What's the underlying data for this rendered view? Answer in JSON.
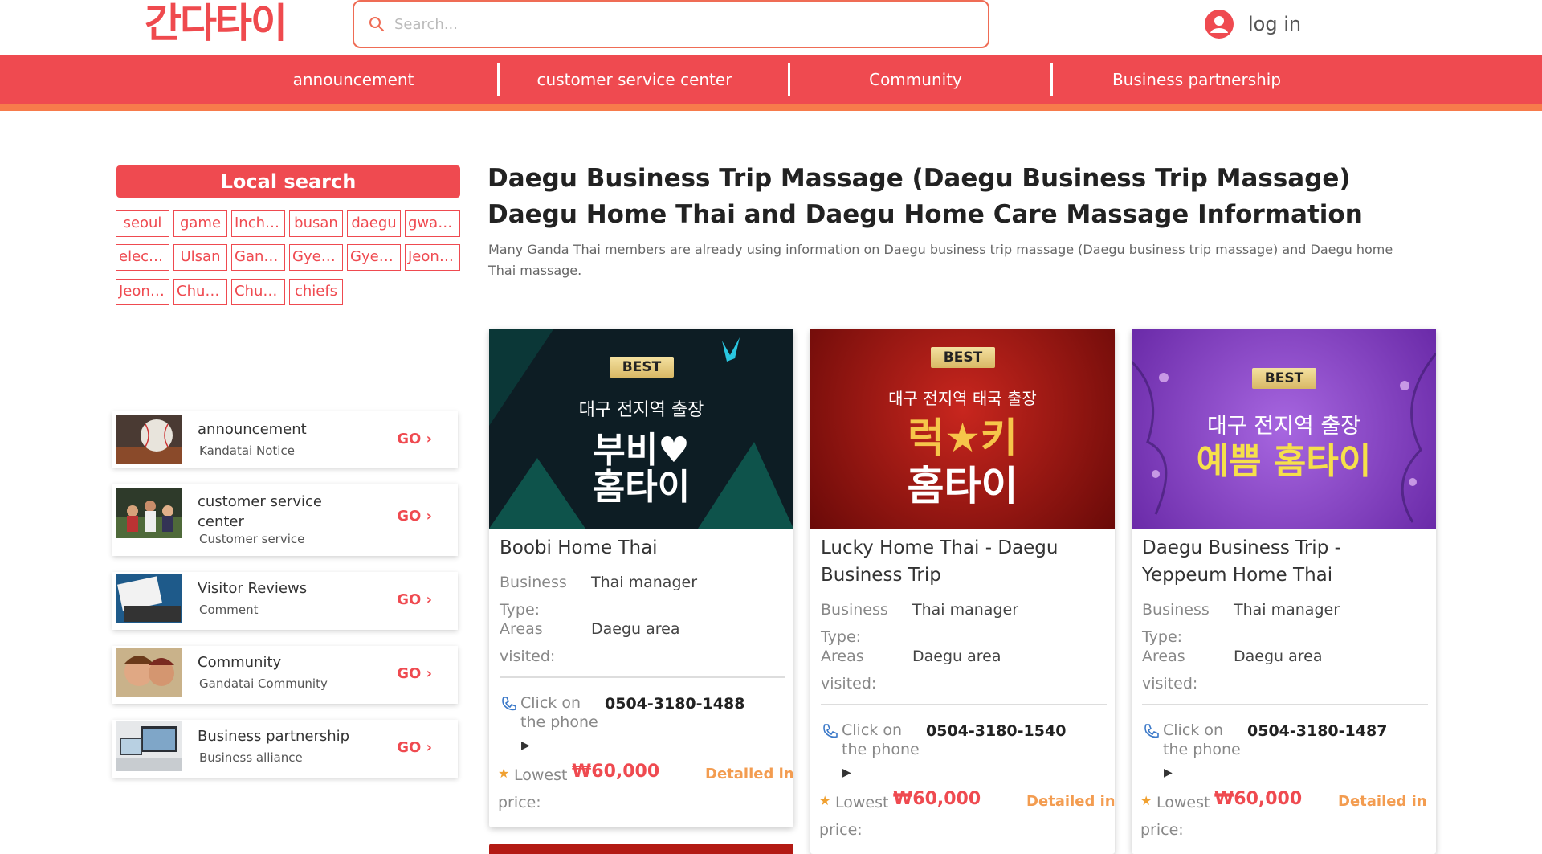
{
  "header": {
    "logo_text": "간다타이",
    "search_placeholder": "Search...",
    "login_label": "log in"
  },
  "nav": {
    "items": [
      {
        "label": "announcement"
      },
      {
        "label": "customer service center"
      },
      {
        "label": "Community"
      },
      {
        "label": "Business partnership"
      }
    ]
  },
  "sidebar": {
    "local_search_title": "Local search",
    "regions": [
      "seoul",
      "game",
      "Incheon",
      "busan",
      "daegu",
      "gwangju",
      "electric",
      "Ulsan",
      "Gangwon",
      "Gyeonggi",
      "Gyeongbuk",
      "Jeonbuk",
      "Jeonnam",
      "Chungbuk",
      "Chungnam",
      "chiefs"
    ],
    "links": [
      {
        "title": "announcement",
        "subtitle": "Kandatai Notice",
        "go": "GO"
      },
      {
        "title": "customer service center",
        "subtitle": "Customer service",
        "go": "GO"
      },
      {
        "title": "Visitor Reviews",
        "subtitle": "Comment",
        "go": "GO"
      },
      {
        "title": "Community",
        "subtitle": "Gandatai Community",
        "go": "GO"
      },
      {
        "title": "Business partnership",
        "subtitle": "Business alliance",
        "go": "GO"
      }
    ]
  },
  "main": {
    "title": "Daegu Business Trip Massage (Daegu Business Trip Massage) Daegu Home Thai and Daegu Home Care Massage Information",
    "description": "Many Ganda Thai members are already using information on Daegu business trip massage (Daegu business trip massage) and Daegu home Thai massage."
  },
  "cards": [
    {
      "banner": {
        "badge": "BEST",
        "line1": "대구 전지역 출장",
        "big1": "부비♥",
        "big2": "홈타이"
      },
      "name": "Boobi Home Thai",
      "business_type_label": "Business Type:",
      "business_type_value": "Thai manager",
      "areas_label": "Areas visited:",
      "areas_value": "Daegu area",
      "click_label": "Click on the phone",
      "phone": "0504-3180-1488",
      "lowest_label": "Lowest price:",
      "price": "₩60,000",
      "detail": "Detailed information"
    },
    {
      "banner": {
        "badge": "BEST",
        "line1": "대구 전지역 태국 출장",
        "big1": "럭★키",
        "big2": "홈타이"
      },
      "name": "Lucky Home Thai - Daegu Business Trip",
      "business_type_label": "Business Type:",
      "business_type_value": "Thai manager",
      "areas_label": "Areas visited:",
      "areas_value": "Daegu area",
      "click_label": "Click on the phone",
      "phone": "0504-3180-1540",
      "lowest_label": "Lowest price:",
      "price": "₩60,000",
      "detail": "Detailed information"
    },
    {
      "banner": {
        "badge": "BEST",
        "line1": "대구 전지역 출장",
        "big1": "예쁨 홈타이",
        "big2": ""
      },
      "name": "Daegu Business Trip - Yeppeum Home Thai",
      "business_type_label": "Business Type:",
      "business_type_value": "Thai manager",
      "areas_label": "Areas visited:",
      "areas_value": "Daegu area",
      "click_label": "Click on the phone",
      "phone": "0504-3180-1487",
      "lowest_label": "Lowest price:",
      "price": "₩60,000",
      "detail": "Detailed information"
    }
  ],
  "colors": {
    "brand": "#ef4a50",
    "accent_orange": "#f77b4b",
    "price": "#ef4a50",
    "detail": "#f39c50"
  }
}
